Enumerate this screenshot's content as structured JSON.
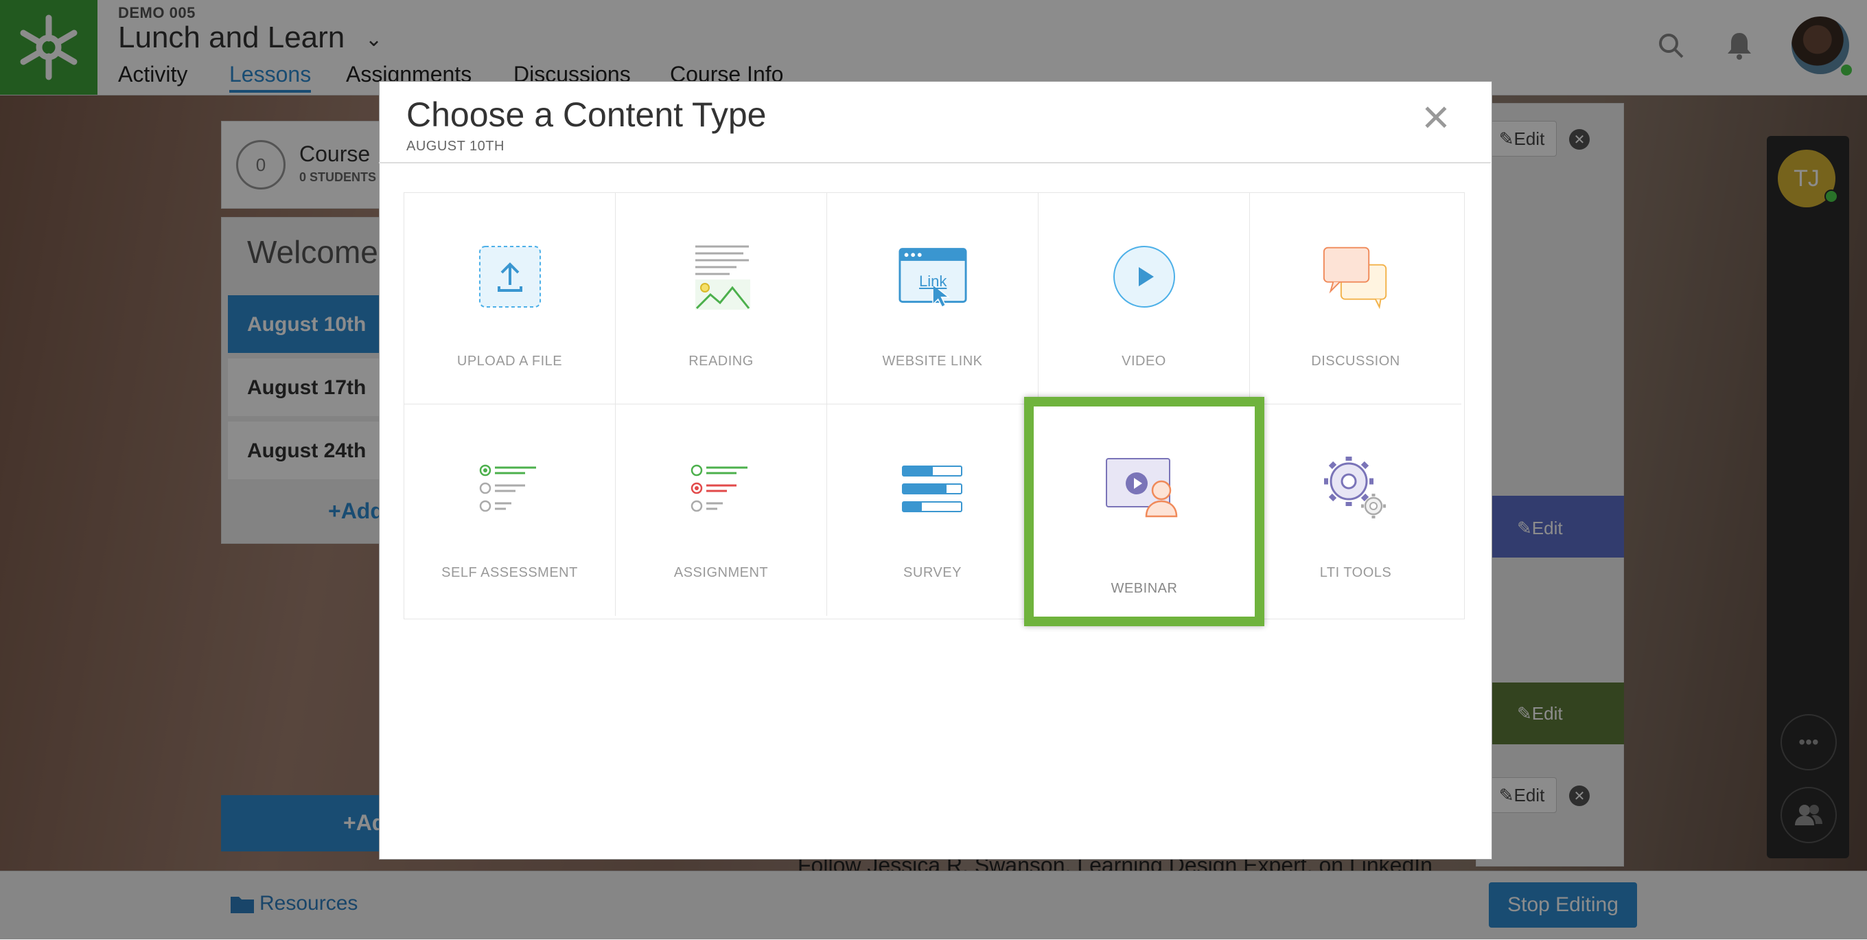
{
  "header": {
    "course_code": "DEMO 005",
    "course_title": "Lunch and Learn",
    "tabs": [
      "Activity",
      "Lessons",
      "Assignments",
      "Discussions",
      "Course Info"
    ],
    "active_tab": "Lessons"
  },
  "left_panel": {
    "count": "0",
    "course_label": "Course",
    "students": "0 STUDENTS",
    "welcome": "Welcome!",
    "lessons": [
      "August 10th",
      "August 17th",
      "August 24th"
    ],
    "add_label": "+Add",
    "add_label_2": "+Ad"
  },
  "right_content": {
    "edit_label": "Edit",
    "follow_text": "Follow Jessica R. Swanson, Learning Design Expert, on LinkedIn"
  },
  "side_rail": {
    "avatar_initials": "TJ",
    "more_icon": "more-icon",
    "people_icon": "people-icon"
  },
  "bottom": {
    "resources": "Resources",
    "stop_editing": "Stop Editing"
  },
  "modal": {
    "title": "Choose a Content Type",
    "subtitle": "AUGUST 10TH",
    "types": [
      {
        "label": "UPLOAD A FILE",
        "icon": "upload-icon"
      },
      {
        "label": "READING",
        "icon": "reading-icon"
      },
      {
        "label": "WEBSITE LINK",
        "icon": "link-icon",
        "icon_text": "Link"
      },
      {
        "label": "VIDEO",
        "icon": "video-icon"
      },
      {
        "label": "DISCUSSION",
        "icon": "discussion-icon"
      },
      {
        "label": "SELF ASSESSMENT",
        "icon": "self-assessment-icon"
      },
      {
        "label": "ASSIGNMENT",
        "icon": "assignment-icon"
      },
      {
        "label": "SURVEY",
        "icon": "survey-icon"
      },
      {
        "label": "WEBINAR",
        "icon": "webinar-icon"
      },
      {
        "label": "LTI TOOLS",
        "icon": "lti-tools-icon"
      }
    ],
    "highlighted": "WEBINAR"
  },
  "colors": {
    "brand_green": "#3fa33a",
    "accent_blue": "#2e8bd0",
    "highlight_green": "#6fb33d"
  }
}
